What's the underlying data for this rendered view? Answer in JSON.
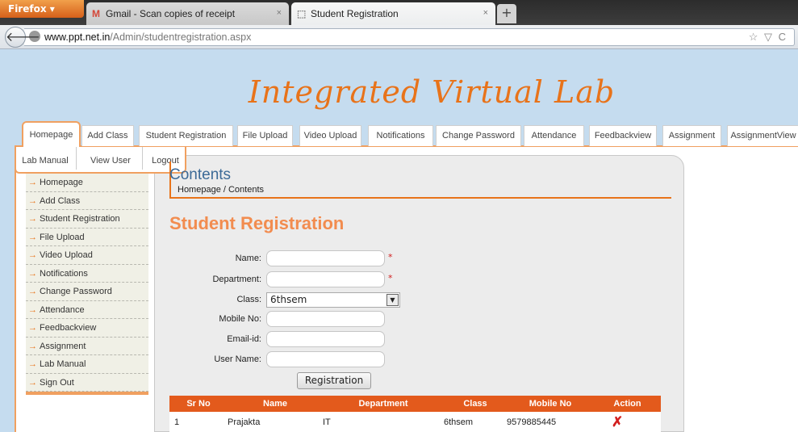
{
  "browser": {
    "firefox_label": "Firefox ▾",
    "tabs": [
      {
        "icon": "M",
        "title": "Gmail - Scan copies of receipt",
        "close": "×"
      },
      {
        "icon": "⬚",
        "title": "Student Registration",
        "close": "×"
      }
    ],
    "new_tab": "+",
    "url_domain": "www.ppt.net.in",
    "url_path": "/Admin/studentregistration.aspx",
    "url_icons": "☆ ▽ C"
  },
  "site": {
    "title": "Integrated Virtual Lab",
    "menu": [
      "Homepage",
      "Add Class",
      "Student Registration",
      "File Upload",
      "Video Upload",
      "Notifications",
      "Change Password",
      "Attendance",
      "Feedbackview",
      "Assignment",
      "AssignmentView"
    ],
    "submenu": [
      "Lab Manual",
      "View User",
      "Logout"
    ],
    "sidebar": [
      "Homepage",
      "Add Class",
      "Student Registration",
      "File Upload",
      "Video Upload",
      "Notifications",
      "Change Password",
      "Attendance",
      "Feedbackview",
      "Assignment",
      "Lab Manual",
      "Sign Out"
    ],
    "arrow": "→"
  },
  "content": {
    "title": "Contents",
    "breadcrumb": "Homepage / Contents",
    "heading": "Student Registration",
    "form": {
      "name_label": "Name:",
      "department_label": "Department:",
      "class_label": "Class:",
      "class_value": "6thsem",
      "mobile_label": "Mobile No:",
      "email_label": "Email-id:",
      "username_label": "User Name:",
      "required_mark": "*",
      "submit": "Registration"
    },
    "table": {
      "headers": [
        "Sr No",
        "Name",
        "Department",
        "Class",
        "Mobile No",
        "Action"
      ],
      "rows": [
        {
          "sr": "1",
          "name": "Prajakta",
          "department": "IT",
          "class": "6thsem",
          "mobile": "9579885445",
          "action": "✗"
        }
      ]
    }
  }
}
